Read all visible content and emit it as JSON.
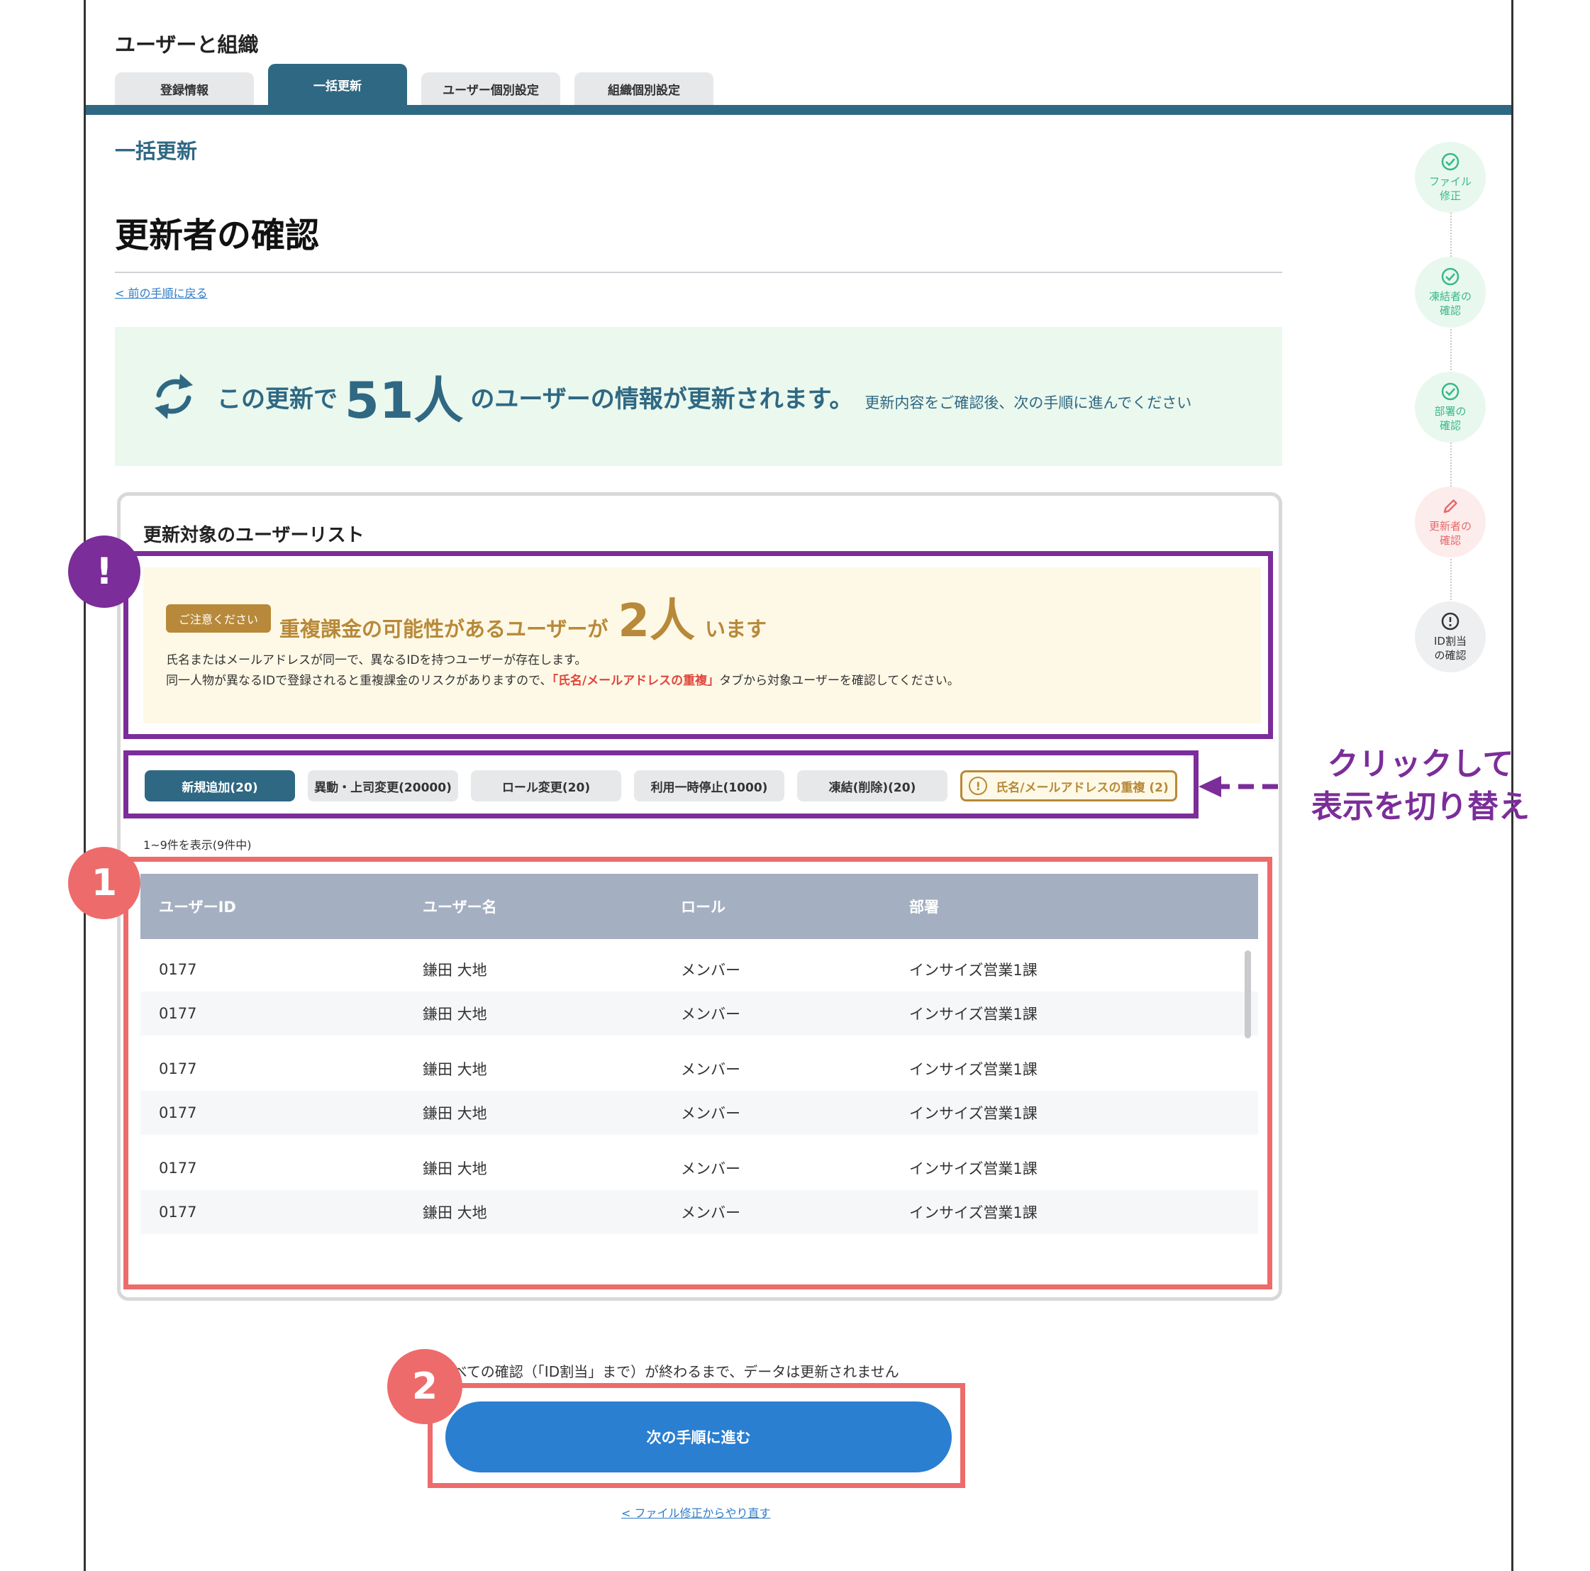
{
  "app_title": "ユーザーと組織",
  "tabs": [
    {
      "label": "登録情報",
      "active": false
    },
    {
      "label": "一括更新",
      "active": true
    },
    {
      "label": "ユーザー個別設定",
      "active": false
    },
    {
      "label": "組織個別設定",
      "active": false
    }
  ],
  "section_label": "一括更新",
  "page_title": "更新者の確認",
  "back_link": "< 前の手順に戻る",
  "summary": {
    "text_before": "この更新で",
    "count": "51人",
    "text_after": "のユーザーの情報が更新されます。",
    "sub": "更新内容をご確認後、次の手順に進んでください",
    "icon": "refresh-icon"
  },
  "list_card": {
    "title": "更新対象のユーザーリスト"
  },
  "warning": {
    "pill": "ご注意ください",
    "headline_before": "重複課金の可能性があるユーザーが",
    "count": "2人",
    "headline_after": "います",
    "line1": "氏名またはメールアドレスが同一で、異なるIDを持つユーザーが存在します。",
    "line2_before": "同一人物が異なるIDで登録されると重複課金のリスクがありますので、",
    "line2_highlight": "「氏名/メールアドレスの重複」",
    "line2_after": "タブから対象ユーザーを確認してください。"
  },
  "filters": [
    {
      "label": "新規追加(20)",
      "active": true
    },
    {
      "label": "異動・上司変更(20000)",
      "active": false
    },
    {
      "label": "ロール変更(20)",
      "active": false
    },
    {
      "label": "利用一時停止(1000)",
      "active": false
    },
    {
      "label": "凍結(削除)(20)",
      "active": false
    },
    {
      "label": "氏名/メールアドレスの重複 (2)",
      "active": false,
      "icon": "exclamation-circle-icon"
    }
  ],
  "annotations": {
    "warning_marker": "!",
    "table_marker": "1",
    "cta_marker": "2",
    "hint_line1": "クリックして",
    "hint_line2": "表示を切り替え"
  },
  "pagination_text": "1~9件を表示(9件中)",
  "table": {
    "headers": [
      "ユーザーID",
      "ユーザー名",
      "ロール",
      "部署"
    ],
    "rows": [
      [
        "0177",
        "鎌田 大地",
        "メンバー",
        "インサイズ営業1課"
      ],
      [
        "0177",
        "鎌田 大地",
        "メンバー",
        "インサイズ営業1課"
      ],
      [
        "0177",
        "鎌田 大地",
        "メンバー",
        "インサイズ営業1課"
      ],
      [
        "0177",
        "鎌田 大地",
        "メンバー",
        "インサイズ営業1課"
      ],
      [
        "0177",
        "鎌田 大地",
        "メンバー",
        "インサイズ営業1課"
      ],
      [
        "0177",
        "鎌田 大地",
        "メンバー",
        "インサイズ営業1課"
      ]
    ]
  },
  "notice": "すべての確認（「ID割当」まで）が終わるまで、データは更新されません",
  "cta_label": "次の手順に進む",
  "restart_link": "< ファイル修正からやり直す",
  "steps": [
    {
      "line1": "ファイル",
      "line2": "修正",
      "state": "done",
      "icon": "check-circle-icon"
    },
    {
      "line1": "凍結者の",
      "line2": "確認",
      "state": "done",
      "icon": "check-circle-icon"
    },
    {
      "line1": "部署の",
      "line2": "確認",
      "state": "done",
      "icon": "check-circle-icon"
    },
    {
      "line1": "更新者の",
      "line2": "確認",
      "state": "current",
      "icon": "pencil-icon"
    },
    {
      "line1": "ID割当",
      "line2": "の確認",
      "state": "todo",
      "icon": "exclamation-circle-icon"
    }
  ],
  "colors": {
    "primary": "#2f6883",
    "cta": "#2a7fd1",
    "warning": "#b8893a",
    "annotation_purple": "#7b2d99",
    "annotation_red": "#ee6b6b"
  }
}
